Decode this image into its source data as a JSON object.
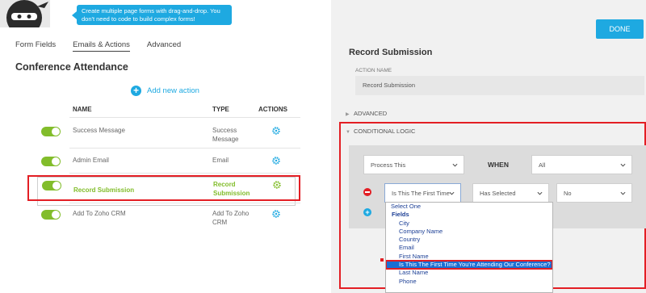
{
  "colors": {
    "accent": "#1ea9e1",
    "active_green": "#82bd2b",
    "highlight_red": "#e31e24",
    "dropdown_selected": "#1a6fd3"
  },
  "tooltip": {
    "text": "Create multiple page forms with drag-and-drop. You don't need to code to build complex forms!"
  },
  "tabs": [
    "Form Fields",
    "Emails & Actions",
    "Advanced"
  ],
  "form_title": "Conference Attendance",
  "add_action_label": "Add new action",
  "table": {
    "headers": {
      "name": "NAME",
      "type": "TYPE",
      "actions": "ACTIONS"
    },
    "rows": [
      {
        "name": "Success Message",
        "type": "Success Message",
        "enabled": true,
        "selected": false
      },
      {
        "name": "Admin Email",
        "type": "Email",
        "enabled": true,
        "selected": false
      },
      {
        "name": "Record Submission",
        "type": "Record Submission",
        "enabled": true,
        "selected": true
      },
      {
        "name": "Add To Zoho CRM",
        "type": "Add To Zoho CRM",
        "enabled": true,
        "selected": false
      }
    ]
  },
  "done_label": "DONE",
  "settings": {
    "title": "Record Submission",
    "action_name_label": "ACTION NAME",
    "action_name_value": "Record Submission",
    "advanced_label": "ADVANCED",
    "conditional_label": "CONDITIONAL LOGIC",
    "process_select": "Process This",
    "when_label": "WHEN",
    "all_select": "All",
    "field_select": "Is This The First Time",
    "operator_select": "Has Selected",
    "value_select": "No"
  },
  "dropdown": {
    "items": [
      {
        "label": "Select One",
        "kind": "option"
      },
      {
        "label": "Fields",
        "kind": "group"
      },
      {
        "label": "City",
        "kind": "child"
      },
      {
        "label": "Company Name",
        "kind": "child"
      },
      {
        "label": "Country",
        "kind": "child"
      },
      {
        "label": "Email",
        "kind": "child"
      },
      {
        "label": "First Name",
        "kind": "child"
      },
      {
        "label": "Is This The First Time You're Attending Our Conference?",
        "kind": "child",
        "highlighted": true
      },
      {
        "label": "Last Name",
        "kind": "child"
      },
      {
        "label": "Phone",
        "kind": "child"
      }
    ]
  }
}
